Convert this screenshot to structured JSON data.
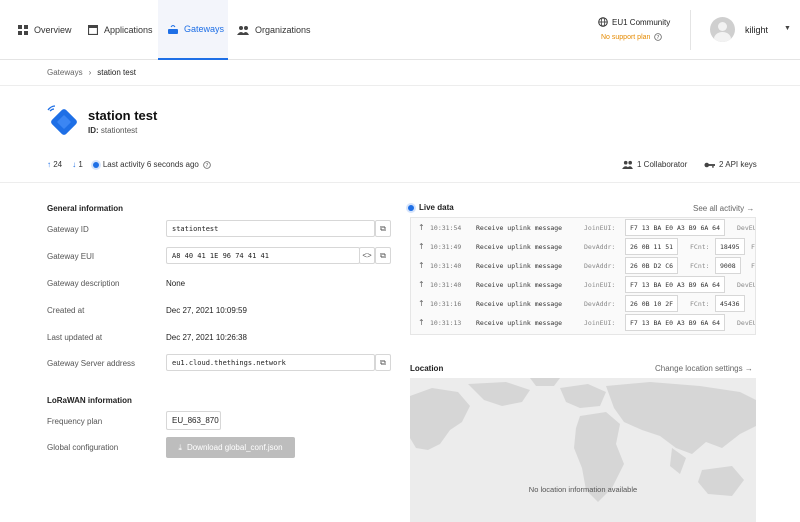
{
  "nav": {
    "items": [
      {
        "label": "Overview",
        "icon": "overview-icon"
      },
      {
        "label": "Applications",
        "icon": "applications-icon"
      },
      {
        "label": "Gateways",
        "icon": "gateways-icon",
        "active": true
      },
      {
        "label": "Organizations",
        "icon": "organizations-icon"
      }
    ],
    "community": "EU1 Community",
    "support": "No support plan",
    "username": "kilight"
  },
  "breadcrumb": {
    "parent": "Gateways",
    "current": "station test"
  },
  "gateway": {
    "title": "station test",
    "id_label": "ID:",
    "id": "stationtest",
    "uplinks": "24",
    "downlinks": "1",
    "last_activity": "Last activity 6 seconds ago",
    "collaborators": "1 Collaborator",
    "api_keys": "2 API keys"
  },
  "general": {
    "title": "General information",
    "rows": {
      "gateway_id": {
        "label": "Gateway ID",
        "value": "stationtest"
      },
      "gateway_eui": {
        "label": "Gateway EUI",
        "value": "A8 40 41 1E 96 74 41 41"
      },
      "description": {
        "label": "Gateway description",
        "value": "None"
      },
      "created": {
        "label": "Created at",
        "value": "Dec 27, 2021 10:09:59"
      },
      "updated": {
        "label": "Last updated at",
        "value": "Dec 27, 2021 10:26:38"
      },
      "server": {
        "label": "Gateway Server address",
        "value": "eu1.cloud.thethings.network"
      }
    }
  },
  "lorawan": {
    "title": "LoRaWAN information",
    "frequency_label": "Frequency plan",
    "frequency_value": "EU_863_870",
    "global_config_label": "Global configuration",
    "download_label": "Download global_conf.json"
  },
  "live": {
    "title": "Live data",
    "see_all": "See all activity →",
    "rows": [
      {
        "time": "10:31:54",
        "msg": "Receive uplink message",
        "k1": "JoinEUI:",
        "v1": "F7 13 BA E0 A3 B9 6A 64",
        "k2": "DevEU",
        "v2": "",
        "k3": ""
      },
      {
        "time": "10:31:49",
        "msg": "Receive uplink message",
        "k1": "DevAddr:",
        "v1": "26 0B 11 51",
        "k2": "FCnt:",
        "v2": "18495",
        "k3": "F"
      },
      {
        "time": "10:31:40",
        "msg": "Receive uplink message",
        "k1": "DevAddr:",
        "v1": "26 0B D2 C6",
        "k2": "FCnt:",
        "v2": "9008",
        "k3": "F"
      },
      {
        "time": "10:31:40",
        "msg": "Receive uplink message",
        "k1": "JoinEUI:",
        "v1": "F7 13 BA E0 A3 B9 6A 64",
        "k2": "DevEU",
        "v2": "",
        "k3": ""
      },
      {
        "time": "10:31:16",
        "msg": "Receive uplink message",
        "k1": "DevAddr:",
        "v1": "26 0B 10 2F",
        "k2": "FCnt:",
        "v2": "45436",
        "k3": ""
      },
      {
        "time": "10:31:13",
        "msg": "Receive uplink message",
        "k1": "JoinEUI:",
        "v1": "F7 13 BA E0 A3 B9 6A 64",
        "k2": "DevEU",
        "v2": "",
        "k3": ""
      }
    ]
  },
  "location": {
    "title": "Location",
    "change_link": "Change location settings →",
    "empty_message": "No location information available"
  },
  "colors": {
    "accent": "#1e6fe6",
    "warning": "#e58a00",
    "map_bg": "#ececec",
    "land": "#d7d7d7"
  }
}
